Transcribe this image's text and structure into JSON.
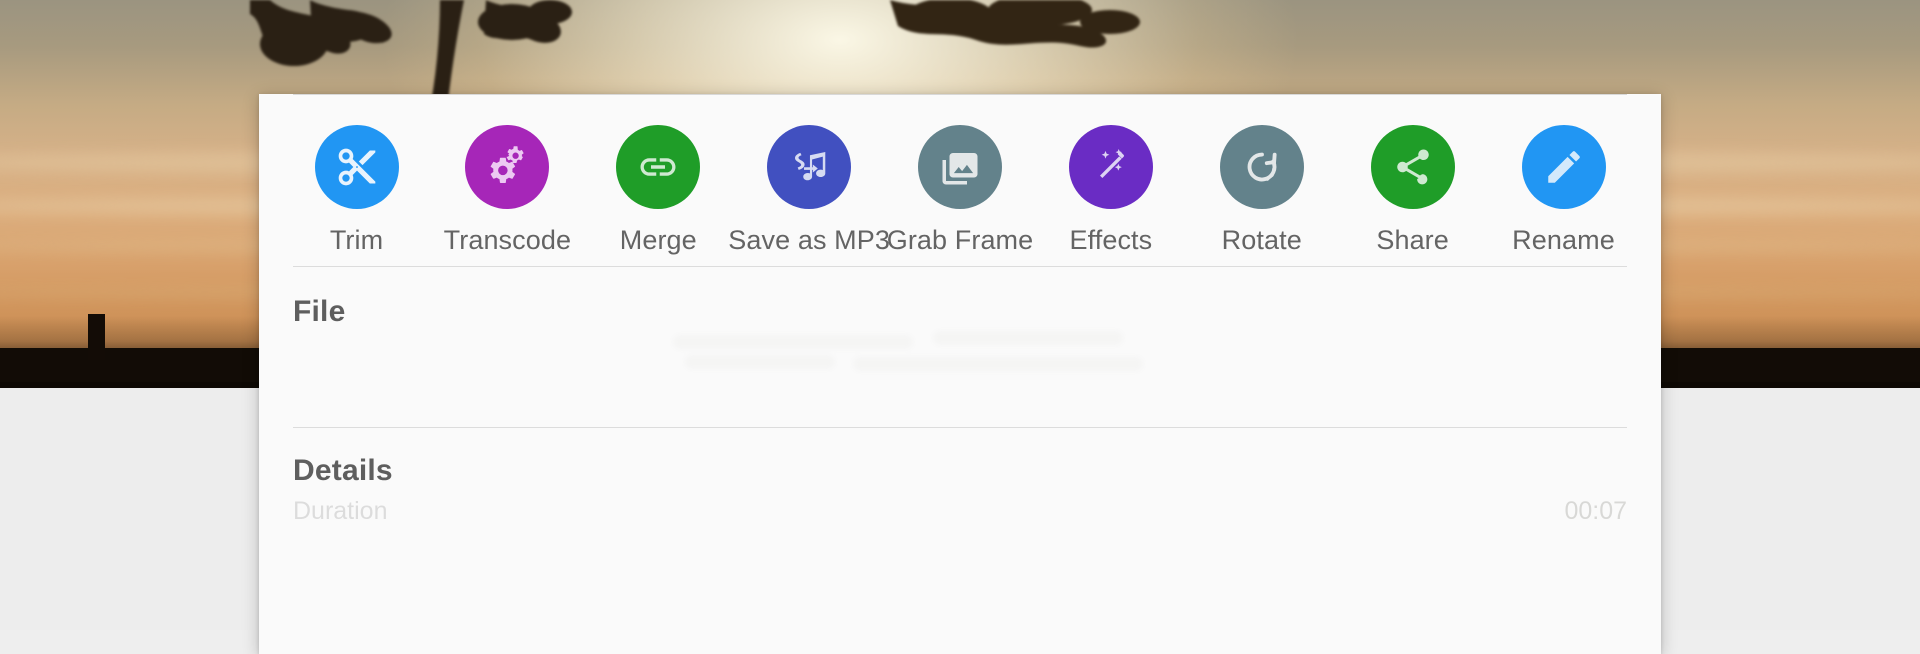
{
  "background": {
    "scene": "sunset-sky-with-tree-silhouettes-photo",
    "sky_top_color": "#9b9480",
    "sky_bottom_color": "#c2854c",
    "glow_color": "#fffceb",
    "silhouette_color": "#120c06",
    "page_color": "#ededed"
  },
  "dialog": {
    "surface_color": "#fafafa",
    "divider_color": "#d8d8d8"
  },
  "actions": [
    {
      "id": "trim",
      "label": "Trim",
      "icon": "scissors-icon",
      "color": "#2196f3"
    },
    {
      "id": "transcode",
      "label": "Transcode",
      "icon": "gears-icon",
      "color": "#a626b8"
    },
    {
      "id": "merge",
      "label": "Merge",
      "icon": "link-icon",
      "color": "#1f9d28"
    },
    {
      "id": "save_as_mp3",
      "label": "Save as MP3",
      "icon": "music-note-icon",
      "color": "#4150c0"
    },
    {
      "id": "grab_frame",
      "label": "Grab Frame",
      "icon": "photo-stack-icon",
      "color": "#63828b"
    },
    {
      "id": "effects",
      "label": "Effects",
      "icon": "magic-wand-icon",
      "color": "#6a2cc4"
    },
    {
      "id": "rotate",
      "label": "Rotate",
      "icon": "rotate-cw-icon",
      "color": "#63828b"
    },
    {
      "id": "share",
      "label": "Share",
      "icon": "share-nodes-icon",
      "color": "#1f9d28"
    },
    {
      "id": "rename",
      "label": "Rename",
      "icon": "pencil-icon",
      "color": "#2196f3"
    }
  ],
  "file_section": {
    "title": "File"
  },
  "details_section": {
    "title": "Details",
    "rows": [
      {
        "label": "Duration",
        "value": "00:07"
      }
    ]
  }
}
